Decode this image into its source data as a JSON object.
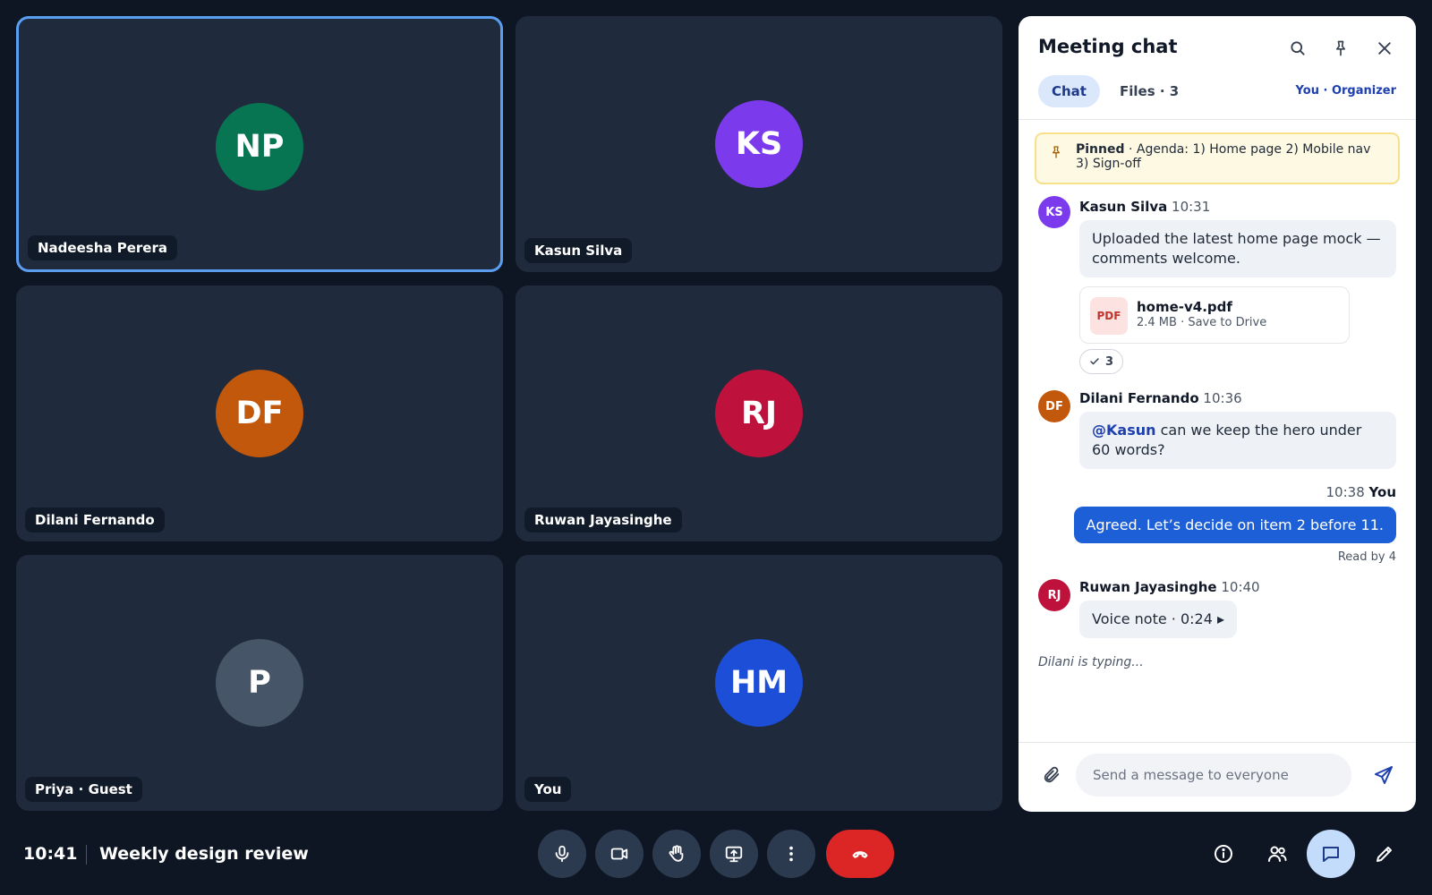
{
  "participants": [
    {
      "initials": "NP",
      "name": "Nadeesha Perera",
      "color": "#077552",
      "active": true
    },
    {
      "initials": "KS",
      "name": "Kasun Silva",
      "color": "#7c3aed",
      "active": false
    },
    {
      "initials": "DF",
      "name": "Dilani Fernando",
      "color": "#c2580c",
      "active": false
    },
    {
      "initials": "RJ",
      "name": "Ruwan Jayasinghe",
      "color": "#be123c",
      "active": false
    },
    {
      "initials": "P",
      "name": "Priya · Guest",
      "color": "#475569",
      "active": false
    },
    {
      "initials": "HM",
      "name": "You",
      "color": "#1d4ed8",
      "active": false
    }
  ],
  "bottom_bar": {
    "time": "10:41",
    "meeting_title": "Weekly design review",
    "controls": [
      "microphone-icon",
      "camera-icon",
      "raise-hand-icon",
      "present-screen-icon",
      "more-options-icon",
      "end-call-icon"
    ],
    "right_actions": [
      "info-icon",
      "people-icon",
      "chat-icon",
      "whiteboard-icon"
    ],
    "chat_active": true
  },
  "chat": {
    "title": "Meeting chat",
    "tabs": {
      "chat": "Chat",
      "files": "Files · 3"
    },
    "role": "You · Organizer",
    "pinned": {
      "label": "Pinned",
      "text": " · Agenda: 1) Home page 2) Mobile nav 3) Sign-off"
    },
    "messages": {
      "kasun": {
        "initials": "KS",
        "name": "Kasun Silva",
        "time": "10:31",
        "text": "Uploaded the latest home page mock — comments welcome."
      },
      "file": {
        "type": "PDF",
        "name": "home-v4.pdf",
        "meta": "2.4 MB · Save to Drive"
      },
      "reaction": {
        "count": "3"
      },
      "dilani": {
        "initials": "DF",
        "name": "Dilani Fernando",
        "time": "10:36",
        "mention": "@Kasun",
        "text": " can we keep the hero under 60 words?"
      },
      "me": {
        "time": "10:38",
        "name": "You",
        "text": "Agreed. Let’s decide on item 2 before 11.",
        "read": "Read by 4"
      },
      "ruwan": {
        "initials": "RJ",
        "name": "Ruwan Jayasinghe",
        "time": "10:40",
        "text": "Voice note · 0:24 ▸"
      }
    },
    "typing": "Dilani is typing...",
    "composer_placeholder": "Send a message to everyone"
  }
}
